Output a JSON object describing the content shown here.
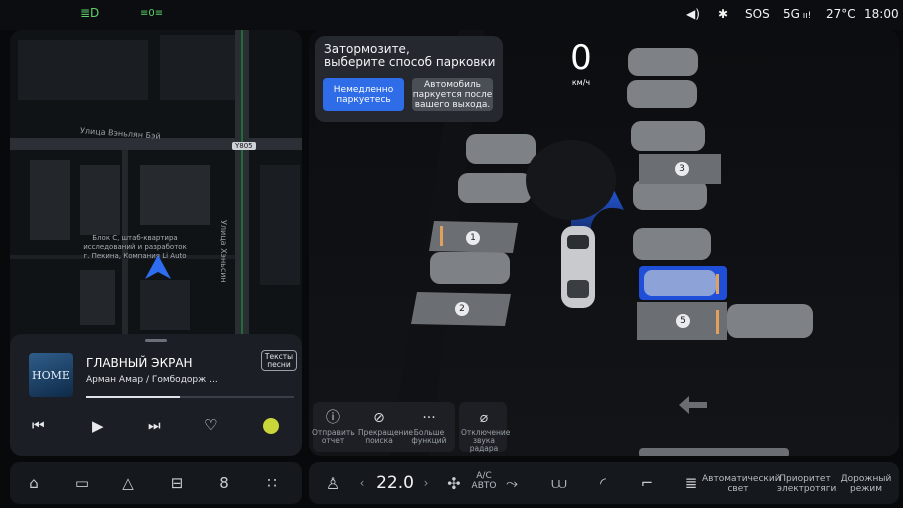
{
  "status_bar": {
    "left_icons": [
      "headlight-icon",
      "fog-light-icon"
    ],
    "volume_icon": "volume-icon",
    "bluetooth_icon": "bluetooth-icon",
    "sos": "SOS",
    "network": "5G",
    "temperature": "27°C",
    "time": "18:00"
  },
  "map": {
    "street_1": "Улица Вэньлян Бэй",
    "street_2": "Улица Хэньсин",
    "road_badge": "Y805",
    "poi_label": "Блок C, штаб-квартира исследований и разработок г. Пекина, Компания Li Auto"
  },
  "media": {
    "album_art_text": "HOME",
    "title": "ГЛАВНЫЙ ЭКРАН",
    "artist": "Арман Амар / Гомбодорж ...",
    "lyrics_button": "Тексты песни",
    "progress": 0.45
  },
  "parking": {
    "prompt_line1": "Затормозите,",
    "prompt_line2": "выберите способ парковки",
    "option_1": "Немедленно паркуетесь",
    "option_2": "Автомобиль паркуется после вашего выхода.",
    "speed": "0",
    "speed_unit": "км/ч",
    "slots": [
      "1",
      "2",
      "3",
      "5"
    ],
    "actions": [
      {
        "label": "Отправить отчет",
        "icon": "report-icon"
      },
      {
        "label": "Прекращение поиска",
        "icon": "stop-search-icon"
      },
      {
        "label": "Больше функций",
        "icon": "more-icon"
      }
    ],
    "radar_mute": "Отключение звука радара"
  },
  "climate": {
    "temperature": "22.0",
    "ac_label": "A/C",
    "ac_mode": "АВТО",
    "auto_light": "Автоматический свет",
    "ev_priority": "Приоритет электротяги",
    "road_mode": "Дорожный режим"
  }
}
